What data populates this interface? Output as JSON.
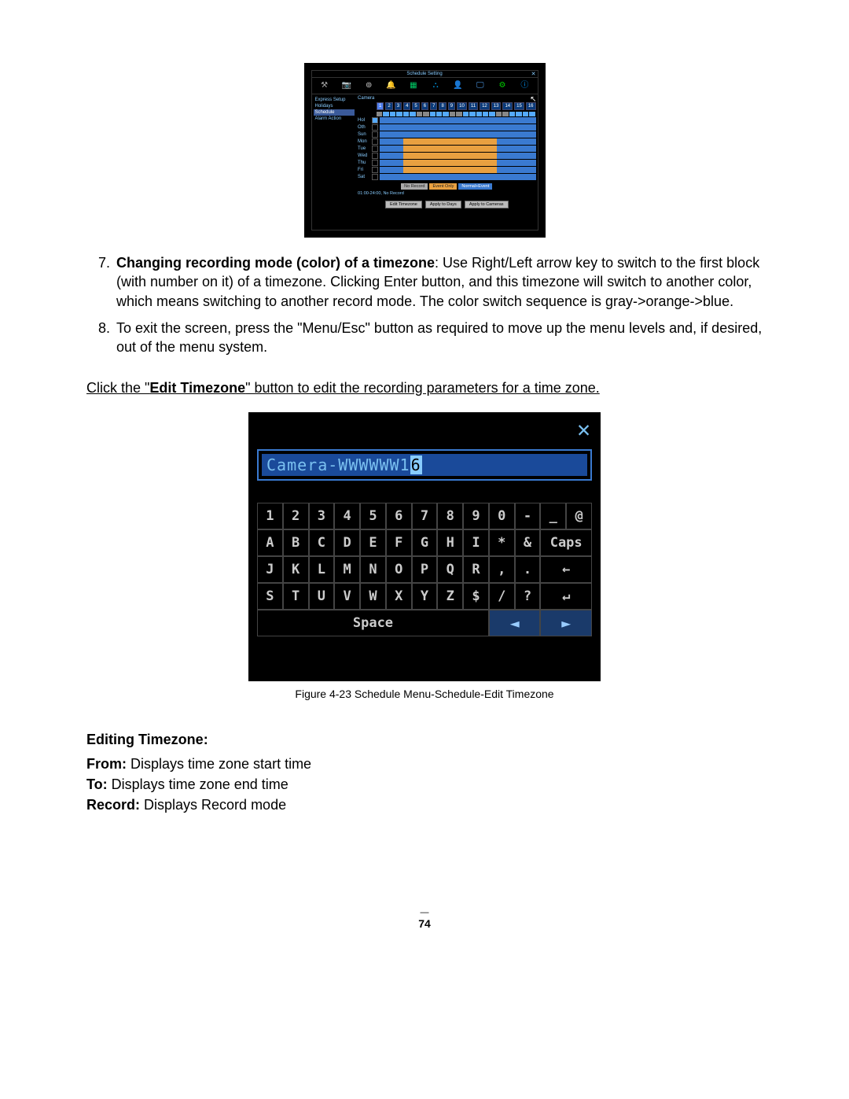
{
  "fig1": {
    "title": "Schedule Setting",
    "sidebar": {
      "items": [
        "Express Setup",
        "Holidays",
        "Schedule",
        "Alarm Action"
      ],
      "selected": 2
    },
    "camera_label": "Camera",
    "camera_nums": [
      "1",
      "2",
      "3",
      "4",
      "5",
      "6",
      "7",
      "8",
      "9",
      "10",
      "11",
      "12",
      "13",
      "14",
      "15",
      "16"
    ],
    "days": [
      "Hol",
      "Oth",
      "Sun",
      "Mon",
      "Tue",
      "Wed",
      "Thu",
      "Fri",
      "Sat"
    ],
    "legend": {
      "no_record": "No Record",
      "event_only": "Event Only",
      "normal_event": "Normal+Event"
    },
    "status": "01:00-24:00, No Record",
    "buttons": {
      "edit": "Edit Timezone",
      "days": "Apply to Days",
      "cameras": "Apply to Cameras"
    }
  },
  "list": {
    "item7": {
      "num": "7.",
      "bold": "Changing recording mode (color) of a timezone",
      "rest": ": Use Right/Left arrow key to switch to the first block (with number on it) of a timezone. Clicking Enter button, and this timezone will switch to another color, which means switching to another record mode. The color switch sequence is gray->orange->blue."
    },
    "item8": {
      "num": "8.",
      "text": "To exit the screen, press the \"Menu/Esc\" button as required to move up the menu levels and, if desired, out of the menu system."
    }
  },
  "click_para": {
    "pre": "Click the \"",
    "bold": "Edit Timezone",
    "post": "\" button to edit the recording parameters for a time zone."
  },
  "fig2": {
    "input_text": "Camera-WWWWWW1",
    "input_cursor": "6",
    "rows": [
      [
        "1",
        "2",
        "3",
        "4",
        "5",
        "6",
        "7",
        "8",
        "9",
        "0",
        "-",
        "_",
        "@"
      ],
      [
        "A",
        "B",
        "C",
        "D",
        "E",
        "F",
        "G",
        "H",
        "I",
        "*",
        "&",
        "Caps"
      ],
      [
        "J",
        "K",
        "L",
        "M",
        "N",
        "O",
        "P",
        "Q",
        "R",
        ",",
        ".",
        "←"
      ],
      [
        "S",
        "T",
        "U",
        "V",
        "W",
        "X",
        "Y",
        "Z",
        "$",
        "/",
        "?",
        "↵"
      ]
    ],
    "space": "Space",
    "nav_left": "◄",
    "nav_right": "►"
  },
  "caption": "Figure 4-23 Schedule Menu-Schedule-Edit Timezone",
  "section": {
    "heading": "Editing Timezone",
    "from_b": "From:",
    "from_t": " Displays time zone start time",
    "to_b": "To:",
    "to_t": " Displays time zone end time",
    "rec_b": "Record:",
    "rec_t": " Displays Record mode"
  },
  "page_num": "74"
}
